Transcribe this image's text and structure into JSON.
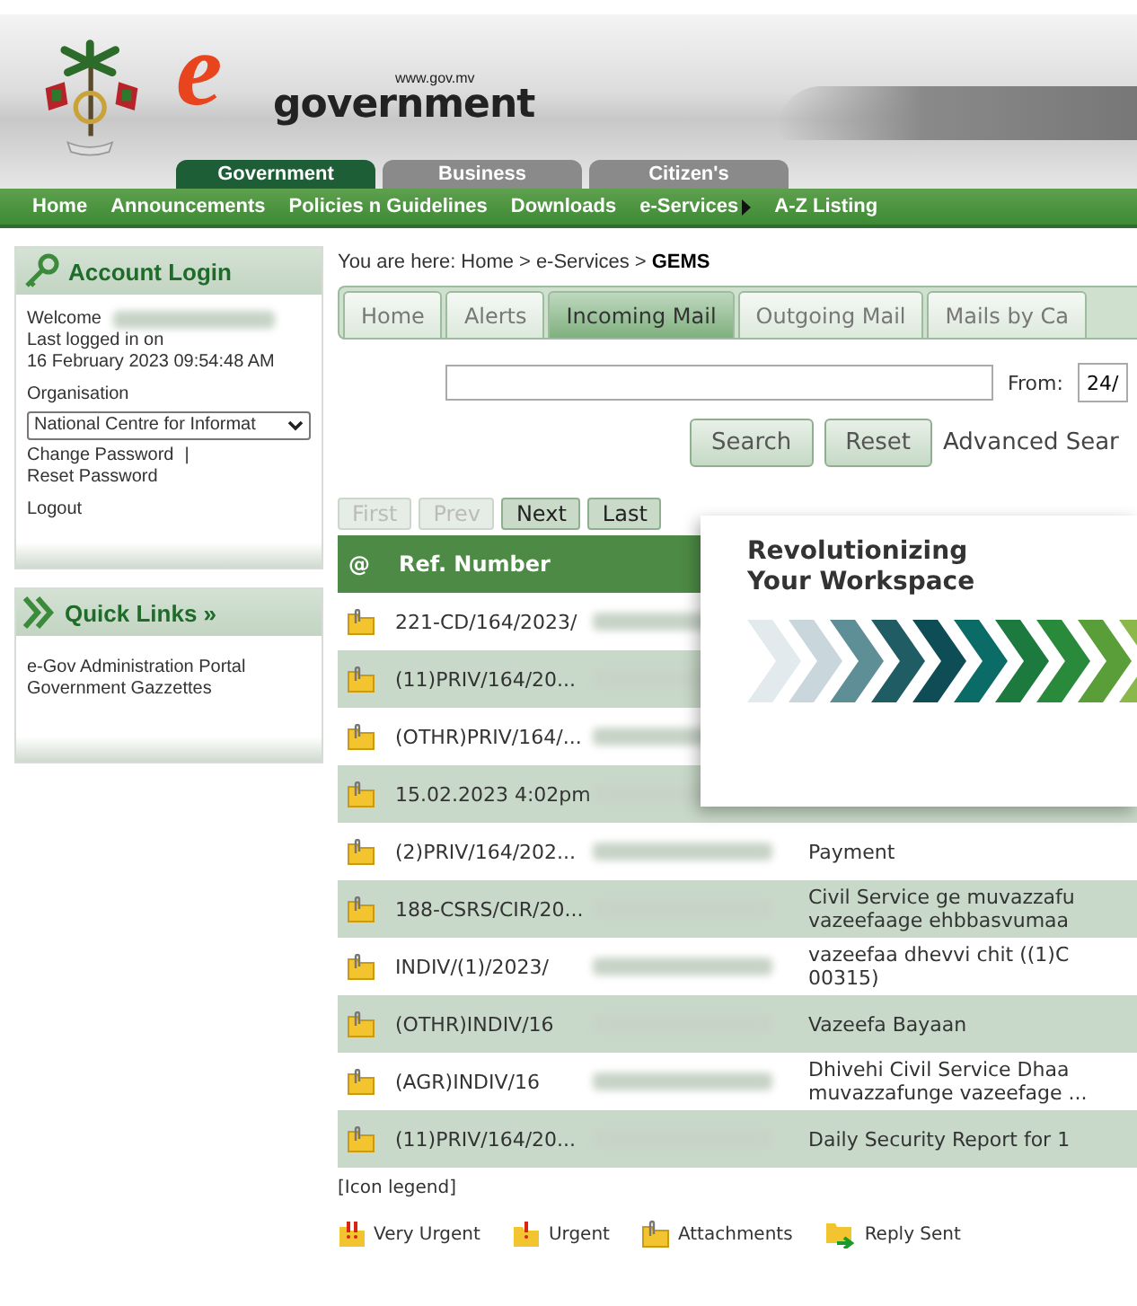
{
  "header": {
    "site_url": "www.gov.mv",
    "logo_word": "government",
    "logo_letter": "e",
    "portal_tabs": [
      {
        "label": "Government",
        "selected": true
      },
      {
        "label": "Business",
        "selected": false
      },
      {
        "label": "Citizen's",
        "selected": false
      }
    ]
  },
  "nav": [
    {
      "label": "Home",
      "kind": "link"
    },
    {
      "label": "Announcements",
      "kind": "link"
    },
    {
      "label": "Policies n Guidelines",
      "kind": "link"
    },
    {
      "label": "Downloads",
      "kind": "link"
    },
    {
      "label": "e-Services",
      "kind": "submenu"
    },
    {
      "label": "A-Z Listing",
      "kind": "link"
    }
  ],
  "account_login": {
    "title": "Account Login",
    "welcome": "Welcome",
    "last_login_label": "Last logged in on",
    "last_login": "16 February 2023 09:54:48 AM",
    "organisation_label": "Organisation",
    "organisation": "National Centre for Informat",
    "change_password": "Change Password",
    "separator": "|",
    "reset_password": "Reset Password",
    "logout": "Logout"
  },
  "quick_links": {
    "title": "Quick Links »",
    "links": [
      "e-Gov Administration Portal",
      "Government Gazzettes"
    ]
  },
  "breadcrumb": {
    "prefix": "You are here:",
    "items": [
      {
        "label": "Home",
        "current": false
      },
      {
        "label": "e-Services",
        "current": false
      },
      {
        "label": "GEMS",
        "current": true
      }
    ],
    "separator": ">"
  },
  "tabs": [
    {
      "label": "Home",
      "selected": false
    },
    {
      "label": "Alerts",
      "selected": false
    },
    {
      "label": "Incoming Mail",
      "selected": true
    },
    {
      "label": "Outgoing Mail",
      "selected": false
    },
    {
      "label": "Mails by Ca",
      "selected": false
    }
  ],
  "search": {
    "from_label": "From:",
    "from_value": "24/",
    "search_button": "Search",
    "reset_button": "Reset",
    "advanced_link": "Advanced Sear"
  },
  "pager": [
    {
      "label": "First",
      "disabled": true
    },
    {
      "label": "Prev",
      "disabled": true
    },
    {
      "label": "Next",
      "disabled": false
    },
    {
      "label": "Last",
      "disabled": false
    }
  ],
  "table": {
    "columns": [
      "@",
      "Ref. Number"
    ],
    "rows": [
      {
        "ref": "221-CD/164/2023/"
      },
      {
        "ref": "(11)PRIV/164/20..."
      },
      {
        "ref": "(OTHR)PRIV/164/..."
      },
      {
        "ref": "15.02.2023 4:02pm"
      },
      {
        "ref": "(2)PRIV/164/202...",
        "subject": "Payment"
      },
      {
        "ref": "188-CSRS/CIR/20...",
        "subject": "Civil Service ge muvazzafu vazeefaage ehbbasvumaa"
      },
      {
        "ref": "INDIV/(1)/2023/",
        "subject": "vazeefaa dhevvi chit ((1)C 00315)"
      },
      {
        "ref": "(OTHR)INDIV/16",
        "subject": "Vazeefa Bayaan"
      },
      {
        "ref": "(AGR)INDIV/16",
        "subject": "Dhivehi Civil Service Dhaa muvazzafunge vazeefage ..."
      },
      {
        "ref": "(11)PRIV/164/20...",
        "subject": "Daily Security Report for 1"
      }
    ]
  },
  "legend": {
    "title": "[Icon legend]",
    "items": [
      {
        "kind": "very-urgent",
        "label": "Very Urgent"
      },
      {
        "kind": "urgent",
        "label": "Urgent"
      },
      {
        "kind": "attachment",
        "label": "Attachments"
      },
      {
        "kind": "reply-sent",
        "label": "Reply Sent"
      }
    ]
  },
  "popup": {
    "title": "Revolutionizing Your Workspace"
  }
}
